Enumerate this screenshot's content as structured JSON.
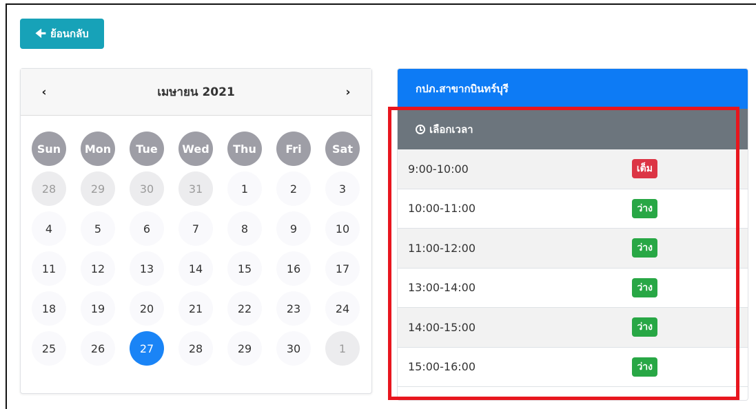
{
  "back_button": {
    "label": "ย้อนกลับ",
    "icon": "arrow-left-icon"
  },
  "calendar": {
    "prev": "‹",
    "next": "›",
    "month_title": "เมษายน 2021",
    "weekdays": [
      "Sun",
      "Mon",
      "Tue",
      "Wed",
      "Thu",
      "Fri",
      "Sat"
    ],
    "days": [
      {
        "d": "28",
        "other": true
      },
      {
        "d": "29",
        "other": true
      },
      {
        "d": "30",
        "other": true
      },
      {
        "d": "31",
        "other": true
      },
      {
        "d": "1"
      },
      {
        "d": "2"
      },
      {
        "d": "3"
      },
      {
        "d": "4"
      },
      {
        "d": "5"
      },
      {
        "d": "6"
      },
      {
        "d": "7"
      },
      {
        "d": "8"
      },
      {
        "d": "9"
      },
      {
        "d": "10"
      },
      {
        "d": "11"
      },
      {
        "d": "12"
      },
      {
        "d": "13"
      },
      {
        "d": "14"
      },
      {
        "d": "15"
      },
      {
        "d": "16"
      },
      {
        "d": "17"
      },
      {
        "d": "18"
      },
      {
        "d": "19"
      },
      {
        "d": "20"
      },
      {
        "d": "21"
      },
      {
        "d": "22"
      },
      {
        "d": "23"
      },
      {
        "d": "24"
      },
      {
        "d": "25"
      },
      {
        "d": "26"
      },
      {
        "d": "27",
        "selected": true
      },
      {
        "d": "28"
      },
      {
        "d": "29"
      },
      {
        "d": "30"
      },
      {
        "d": "1",
        "other": true
      }
    ]
  },
  "time_panel": {
    "branch": "กปภ.สาขากบินทร์บุรี",
    "select_time_label": "เลือกเวลา",
    "slots": [
      {
        "time": "9:00-10:00",
        "status": "เต็ม",
        "kind": "full"
      },
      {
        "time": "10:00-11:00",
        "status": "ว่าง",
        "kind": "free"
      },
      {
        "time": "11:00-12:00",
        "status": "ว่าง",
        "kind": "free"
      },
      {
        "time": "13:00-14:00",
        "status": "ว่าง",
        "kind": "free"
      },
      {
        "time": "14:00-15:00",
        "status": "ว่าง",
        "kind": "free"
      },
      {
        "time": "15:00-16:00",
        "status": "ว่าง",
        "kind": "free"
      }
    ]
  },
  "colors": {
    "back_button": "#17a2b8",
    "branch_header": "#0d7bf5",
    "select_time_header": "#6c757d",
    "badge_full": "#dc3545",
    "badge_free": "#28a745",
    "selected_day": "#1a84f6",
    "highlight_box": "#e8161e"
  }
}
